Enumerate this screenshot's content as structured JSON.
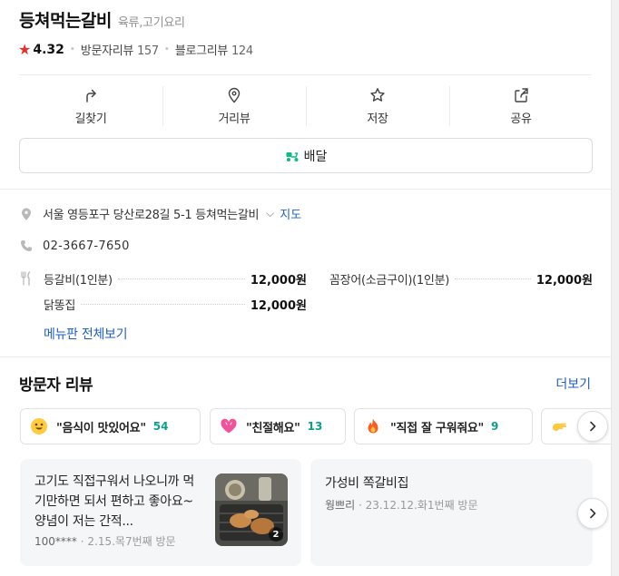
{
  "place": {
    "name": "등쳐먹는갈비",
    "category": "육류,고기요리",
    "rating": "4.32",
    "visitor_reviews_label": "방문자리뷰",
    "visitor_reviews_count": "157",
    "blog_reviews_label": "블로그리뷰",
    "blog_reviews_count": "124"
  },
  "actions": {
    "directions": "길찾기",
    "street_view": "거리뷰",
    "save": "저장",
    "share": "공유"
  },
  "delivery_label": "배달",
  "info": {
    "address": "서울 영등포구 당산로28길 5-1 등쳐먹는갈비",
    "map_link": "지도",
    "phone": "02-3667-7650"
  },
  "menu": {
    "items": [
      {
        "name": "등갈비(1인분)",
        "price": "12,000원"
      },
      {
        "name": "꼼장어(소금구이)(1인분)",
        "price": "12,000원"
      },
      {
        "name": "닭똥집",
        "price": "12,000원"
      }
    ],
    "see_all": "메뉴판 전체보기"
  },
  "reviews": {
    "title": "방문자 리뷰",
    "more": "더보기",
    "keywords": [
      {
        "icon": "smile-emoji-icon",
        "text": "\"음식이 맛있어요\"",
        "count": "54"
      },
      {
        "icon": "heart-emoji-icon",
        "text": "\"친절해요\"",
        "count": "13"
      },
      {
        "icon": "fire-emoji-icon",
        "text": "\"직접 잘 구워줘요\"",
        "count": "9"
      },
      {
        "icon": "hand-emoji-icon",
        "text": "",
        "count": ""
      }
    ],
    "cards": [
      {
        "text": "고기도 직접구워서 나오니까 먹기만하면 되서 편하고 좋아요~양념이 저는 간적...",
        "user": "100****",
        "date": "2.15.목",
        "visit": "7번째 방문",
        "photo_count": "2"
      },
      {
        "text": "가성비 쪽갈비집",
        "user": "웡쁘리",
        "date": "23.12.12.화",
        "visit": "1번째 방문"
      }
    ]
  },
  "colors": {
    "accent_link": "#1f5fc9",
    "rating_star": "#e3302f",
    "keyword_count": "#0c9f8c",
    "delivery_icon": "#12b886"
  }
}
